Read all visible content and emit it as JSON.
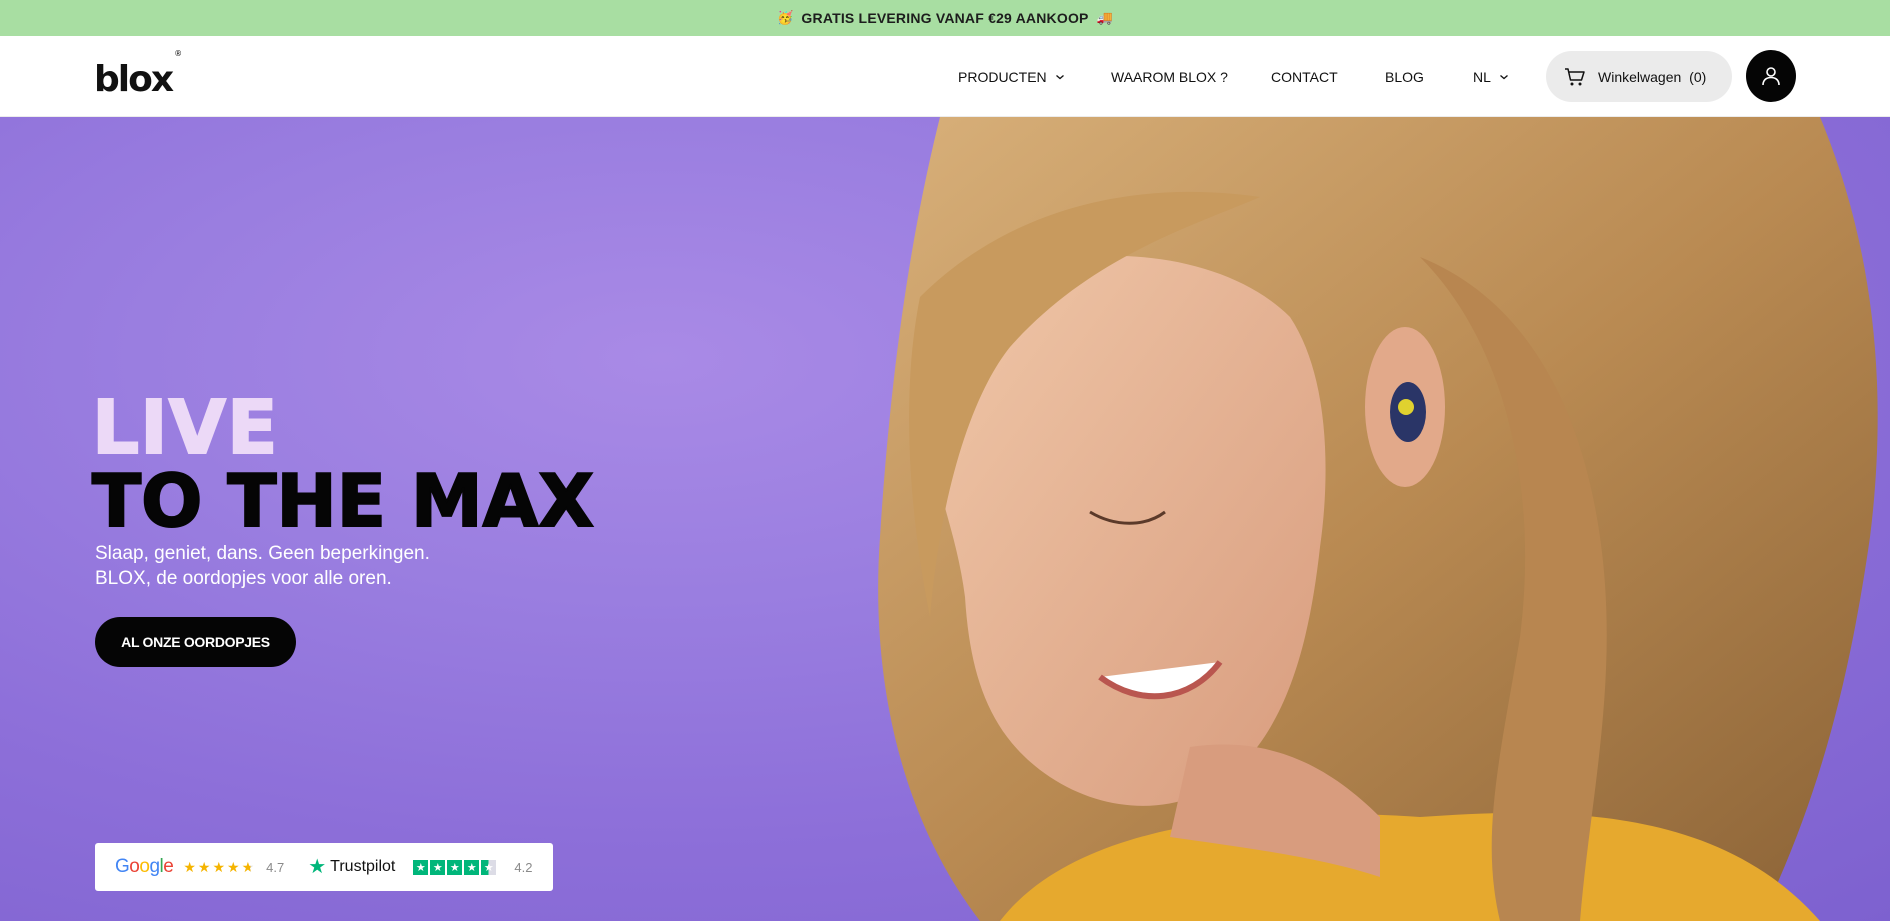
{
  "promo": {
    "left_emoji": "🥳",
    "text": "GRATIS LEVERING VANAF €29 AANKOOP",
    "right_emoji": "🚚"
  },
  "header": {
    "logo": "blox",
    "logo_mark": "®",
    "nav": {
      "producten": "PRODUCTEN",
      "waarom": "WAAROM BLOX ?",
      "contact": "CONTACT",
      "blog": "BLOG",
      "language": "NL"
    },
    "cart": {
      "label": "Winkelwagen",
      "count": "(0)"
    }
  },
  "hero": {
    "headline_line1": "LIVE",
    "headline_line2": "TO THE MAX",
    "subline_1": "Slaap, geniet, dans. Geen beperkingen.",
    "subline_2": "BLOX, de oordopjes voor alle oren.",
    "cta_label": "AL ONZE OORDOPJES"
  },
  "ratings": {
    "google_label": "Google",
    "google_score": "4.7",
    "google_stars": 4.7,
    "trustpilot_label": "Trustpilot",
    "trustpilot_score": "4.2",
    "trustpilot_stars": 4.2
  },
  "colors": {
    "promo_bg": "#a8dea2",
    "hero_bg": "#9a7ee0",
    "headline_light": "#ecd9f7",
    "cta_bg": "#050505",
    "trustpilot_green": "#00b67a",
    "google_star": "#f5b400"
  },
  "icons": {
    "cart": "cart-icon",
    "account": "user-icon",
    "chevron": "chevron-down-icon"
  }
}
